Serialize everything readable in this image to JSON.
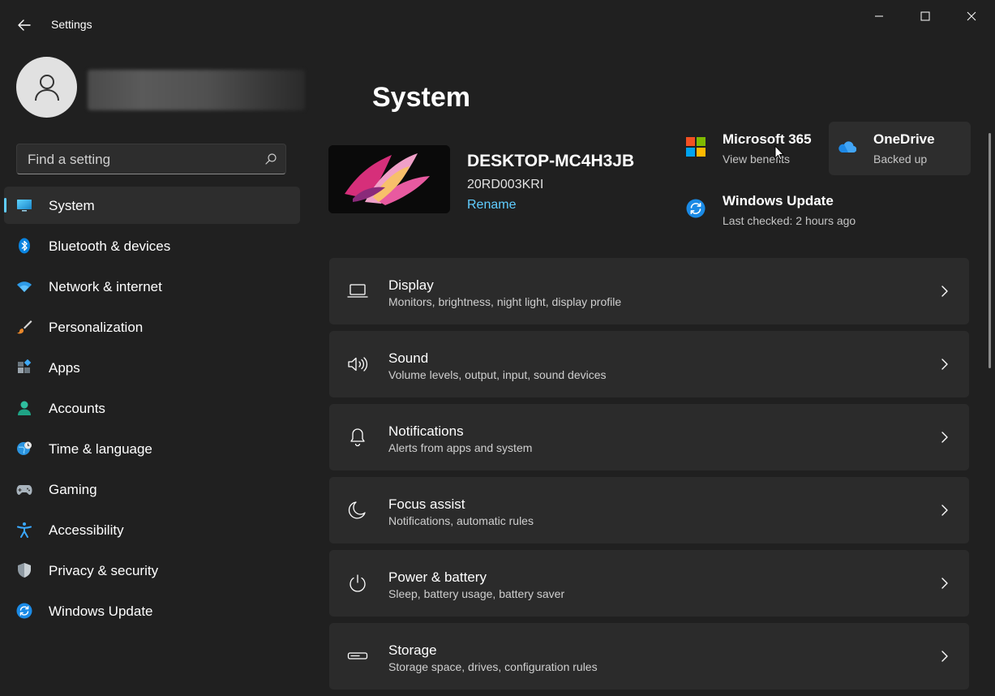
{
  "window": {
    "title": "Settings",
    "controls": {
      "minimize": "minimize",
      "maximize": "maximize",
      "close": "close"
    }
  },
  "user": {
    "avatar_icon": "person-icon"
  },
  "search": {
    "placeholder": "Find a setting",
    "value": ""
  },
  "sidebar": {
    "items": [
      {
        "label": "System",
        "icon": "monitor-icon",
        "active": true
      },
      {
        "label": "Bluetooth & devices",
        "icon": "bluetooth-icon",
        "active": false
      },
      {
        "label": "Network & internet",
        "icon": "wifi-icon",
        "active": false
      },
      {
        "label": "Personalization",
        "icon": "brush-icon",
        "active": false
      },
      {
        "label": "Apps",
        "icon": "apps-icon",
        "active": false
      },
      {
        "label": "Accounts",
        "icon": "accounts-icon",
        "active": false
      },
      {
        "label": "Time & language",
        "icon": "globe-clock-icon",
        "active": false
      },
      {
        "label": "Gaming",
        "icon": "gamepad-icon",
        "active": false
      },
      {
        "label": "Accessibility",
        "icon": "accessibility-icon",
        "active": false
      },
      {
        "label": "Privacy & security",
        "icon": "shield-icon",
        "active": false
      },
      {
        "label": "Windows Update",
        "icon": "update-icon",
        "active": false
      }
    ]
  },
  "main": {
    "title": "System",
    "device": {
      "name": "DESKTOP-MC4H3JB",
      "model": "20RD003KRI",
      "rename": "Rename"
    },
    "quick_links": [
      {
        "title": "Microsoft 365",
        "subtitle": "View benefits",
        "icon": "microsoft-logo-icon"
      },
      {
        "title": "OneDrive",
        "subtitle": "Backed up",
        "icon": "onedrive-cloud-icon"
      },
      {
        "title": "Windows Update",
        "subtitle": "Last checked: 2 hours ago",
        "icon": "update-icon"
      }
    ],
    "settings": [
      {
        "title": "Display",
        "subtitle": "Monitors, brightness, night light, display profile",
        "icon": "laptop-icon"
      },
      {
        "title": "Sound",
        "subtitle": "Volume levels, output, input, sound devices",
        "icon": "speaker-icon"
      },
      {
        "title": "Notifications",
        "subtitle": "Alerts from apps and system",
        "icon": "bell-icon"
      },
      {
        "title": "Focus assist",
        "subtitle": "Notifications, automatic rules",
        "icon": "moon-icon"
      },
      {
        "title": "Power & battery",
        "subtitle": "Sleep, battery usage, battery saver",
        "icon": "power-icon"
      },
      {
        "title": "Storage",
        "subtitle": "Storage space, drives, configuration rules",
        "icon": "storage-drive-icon"
      }
    ]
  },
  "colors": {
    "background": "#202020",
    "card": "#2b2b2b",
    "selected": "#2d2d2d",
    "accent": "#60cdff",
    "text_primary": "#ffffff",
    "text_secondary": "#cfcfcf"
  }
}
